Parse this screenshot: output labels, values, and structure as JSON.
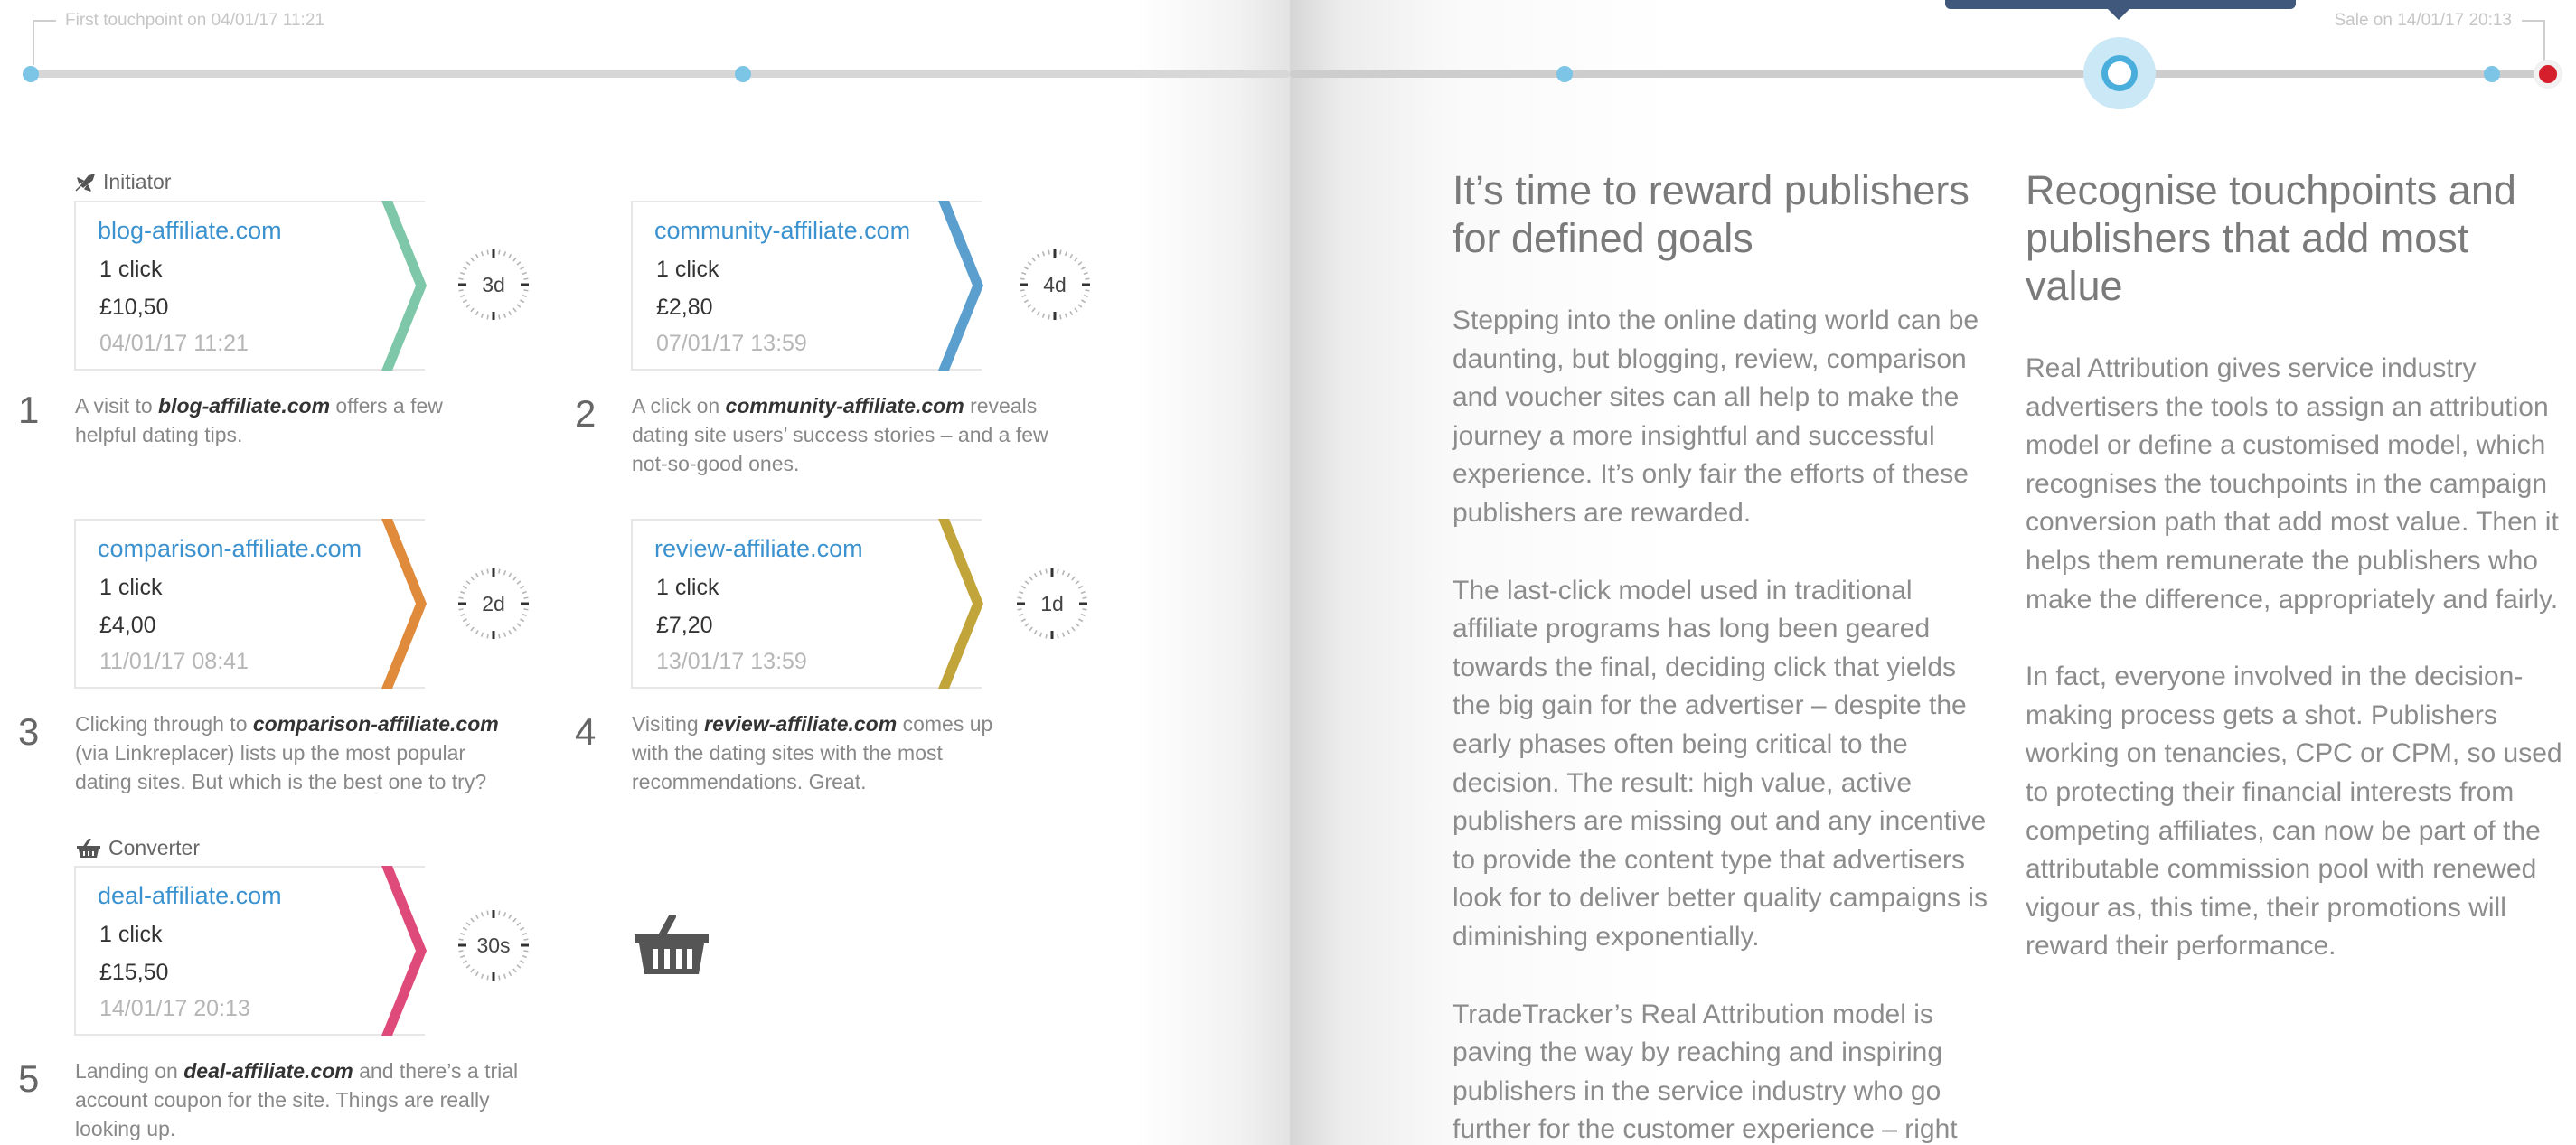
{
  "timeline": {
    "first_label": "First touchpoint on 04/01/17 11:21",
    "sale_label": "Sale on 14/01/17 20:13",
    "accent_color": "#4aaedd",
    "sale_color": "#d61f2c"
  },
  "roles": {
    "initiator": "Initiator",
    "converter": "Converter"
  },
  "touchpoints": [
    {
      "domain": "blog-affiliate.com",
      "clicks": "1 click",
      "amount": "£10,50",
      "date": "04/01/17 11:21",
      "interval": "3d",
      "color": "#7ec8a9"
    },
    {
      "domain": "community-affiliate.com",
      "clicks": "1 click",
      "amount": "£2,80",
      "date": "07/01/17 13:59",
      "interval": "4d",
      "color": "#5b9fcf"
    },
    {
      "domain": "comparison-affiliate.com",
      "clicks": "1 click",
      "amount": "£4,00",
      "date": "11/01/17 08:41",
      "interval": "2d",
      "color": "#e08a3c"
    },
    {
      "domain": "review-affiliate.com",
      "clicks": "1 click",
      "amount": "£7,20",
      "date": "13/01/17 13:59",
      "interval": "1d",
      "color": "#c2a53a"
    },
    {
      "domain": "deal-affiliate.com",
      "clicks": "1 click",
      "amount": "£15,50",
      "date": "14/01/17 20:13",
      "interval": "30s",
      "color": "#de4a7a"
    }
  ],
  "steps": [
    {
      "num": "1",
      "pre": "A visit to ",
      "bold": "blog-affiliate.com",
      "post": " offers a few helpful dating tips."
    },
    {
      "num": "2",
      "pre": "A click on ",
      "bold": "community-affiliate.com",
      "post": " reveals dating site users’ success stories – and a few not-so-good ones."
    },
    {
      "num": "3",
      "pre": "Clicking through to ",
      "bold": "comparison-affiliate.com",
      "post": " (via Linkreplacer) lists up the most popular dating sites. But which is the best one to try?"
    },
    {
      "num": "4",
      "pre": "Visiting ",
      "bold": "review-affiliate.com",
      "post": " comes up with the dating sites with the most recommendations. Great."
    },
    {
      "num": "5",
      "pre": "Landing on ",
      "bold": "deal-affiliate.com",
      "post": " and there’s a trial account coupon for the site. Things are really looking up."
    }
  ],
  "article": {
    "col1_heading": "It’s time to reward publishers for defined goals",
    "col1_p1": "Stepping into the online dating world can be daunting, but blogging, review, comparison and voucher sites can all help to make the journey a more insightful and successful experience. It’s only fair the efforts of these publishers are rewarded.",
    "col1_p2": "The last-click model used in traditional affiliate programs has long been geared towards the final, deciding click that yields the big gain for the advertiser – despite the early phases often being critical to the decision. The result: high value, active publishers are missing out and any incentive to provide the content type that advertisers look for to deliver better quality campaigns is diminishing exponentially.",
    "col1_p3": "TradeTracker’s Real Attribution model is paving the way by reaching and inspiring publishers in the service industry who go further for the customer experience – right",
    "col2_heading": "Recognise touchpoints and publishers that add most value",
    "col2_p1": "Real Attribution gives service industry advertisers the tools to assign an attribution model or define a customised model, which recognises the touchpoints in the campaign conversion path that add most value. Then it helps them remunerate the publishers who make the difference, appropriately and fairly.",
    "col2_p2": "In fact, everyone involved in the decision-making process gets a shot. Publishers working on tenancies, CPC or CPM, so used to protecting their financial interests from competing affiliates, can now be part of the attributable commission pool with renewed vigour as, this time, their promotions will reward their performance."
  }
}
